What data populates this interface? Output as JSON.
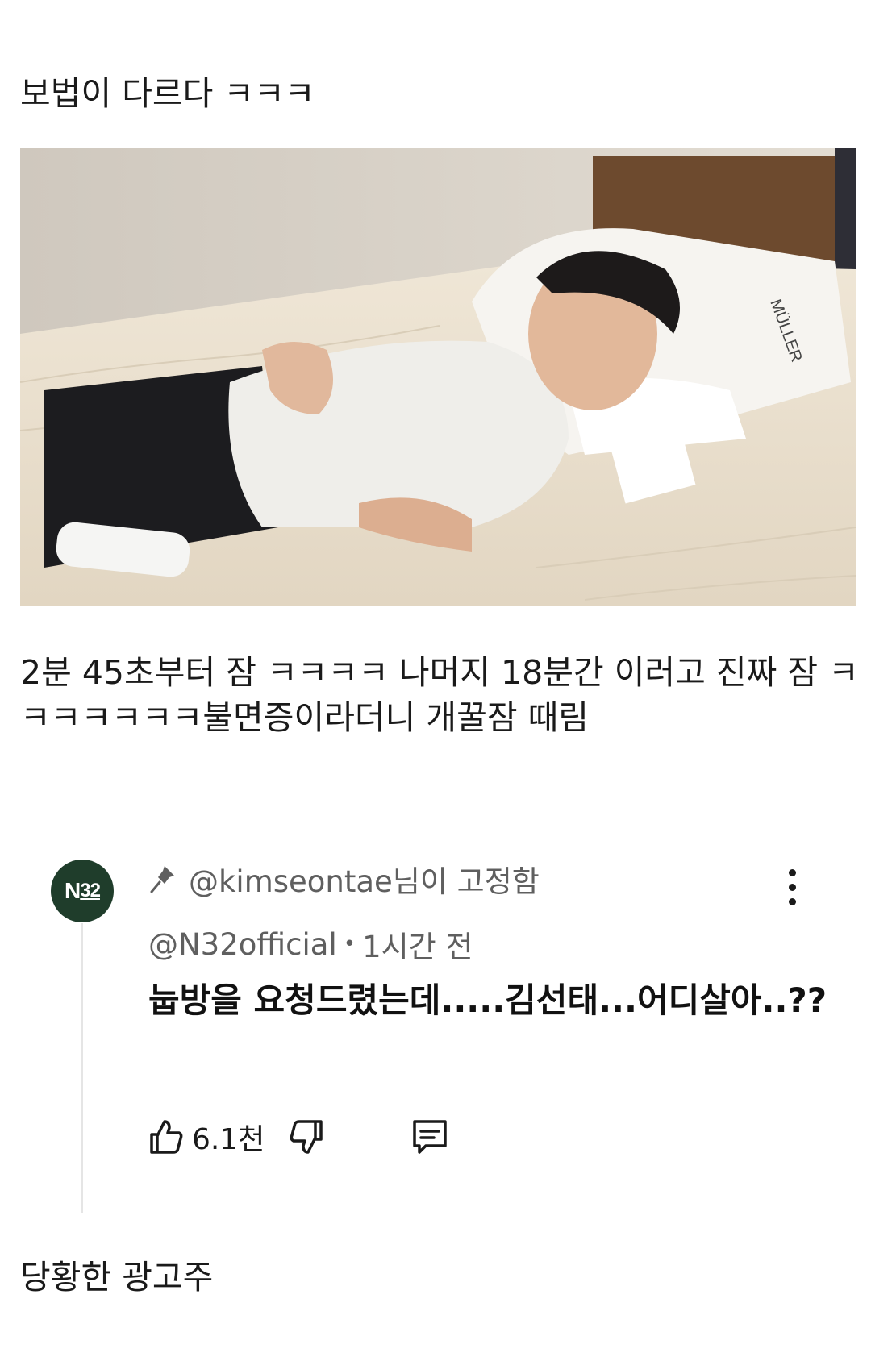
{
  "post": {
    "headline": "보법이 다르다 ㅋㅋㅋ",
    "caption": "2분 45초부터 잠 ㅋㅋㅋㅋ 나머지 18분간 이러고 진짜 잠 ㅋㅋㅋㅋㅋㅋㅋ불면증이라더니 개꿀잠 때림",
    "footer": "당황한 광고주"
  },
  "photo": {
    "pillow_brand": "MÜLLER"
  },
  "comment": {
    "avatar_label": "N",
    "avatar_sub": "32",
    "pinned_text": "@kimseontae님이 고정함",
    "author": "@N32official",
    "separator": "•",
    "time": "1시간 전",
    "body": "눕방을 요청드렸는데.....김선태...어디살아..??",
    "like_count": "6.1천"
  },
  "icons": {
    "pin": "pin-icon",
    "more": "more-vertical-icon",
    "like": "thumbs-up-icon",
    "dislike": "thumbs-down-icon",
    "reply": "reply-icon"
  },
  "colors": {
    "avatar_bg": "#1f3d2b",
    "secondary_text": "#5f5f5f"
  }
}
